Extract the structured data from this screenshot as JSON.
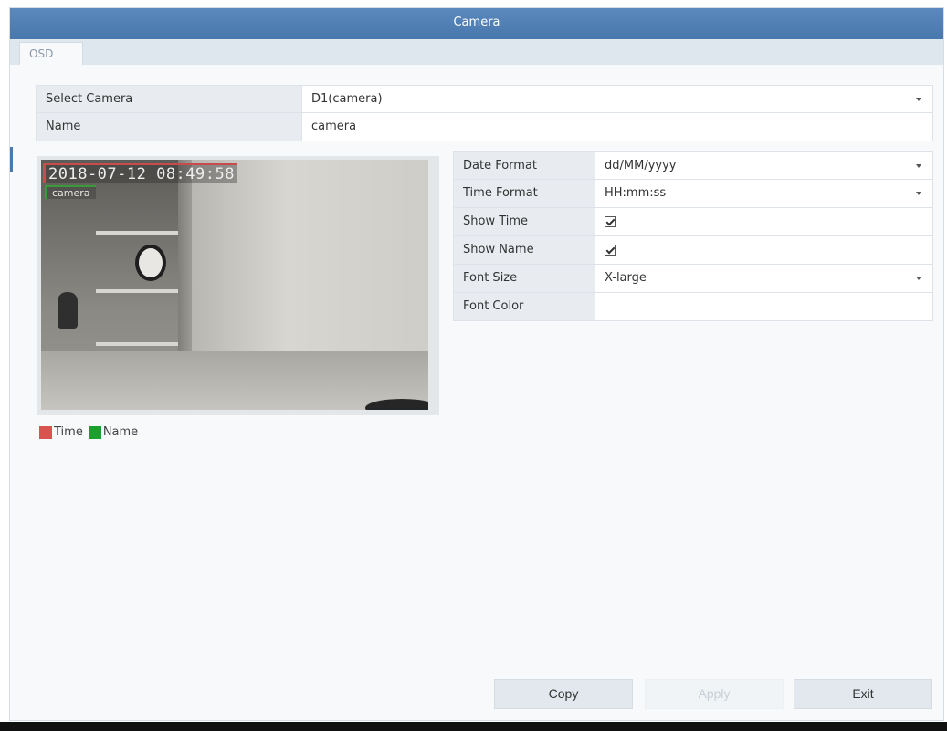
{
  "window": {
    "title": "Camera"
  },
  "tabs": [
    {
      "label": "OSD",
      "active": true
    }
  ],
  "top_form": {
    "select_camera": {
      "label": "Select Camera",
      "value": "D1(camera)"
    },
    "name": {
      "label": "Name",
      "value": "camera"
    }
  },
  "preview": {
    "osd_time_text": "2018-07-12 08:49:58",
    "osd_name_text": "camera",
    "legend": [
      {
        "label": "Time",
        "color": "#d9534f"
      },
      {
        "label": "Name",
        "color": "#1e9e2e"
      }
    ]
  },
  "osd_settings": {
    "date_format": {
      "label": "Date Format",
      "value": "dd/MM/yyyy"
    },
    "time_format": {
      "label": "Time Format",
      "value": "HH:mm:ss"
    },
    "show_time": {
      "label": "Show Time",
      "checked": true
    },
    "show_name": {
      "label": "Show Name",
      "checked": true
    },
    "font_size": {
      "label": "Font Size",
      "value": "X-large"
    },
    "font_color": {
      "label": "Font Color",
      "value": ""
    }
  },
  "buttons": {
    "copy": "Copy",
    "apply": "Apply",
    "exit": "Exit"
  },
  "colors": {
    "titlebar": "#4f7fb4",
    "label_bg": "#e8ecf0",
    "button_bg": "#e2e8ee"
  }
}
